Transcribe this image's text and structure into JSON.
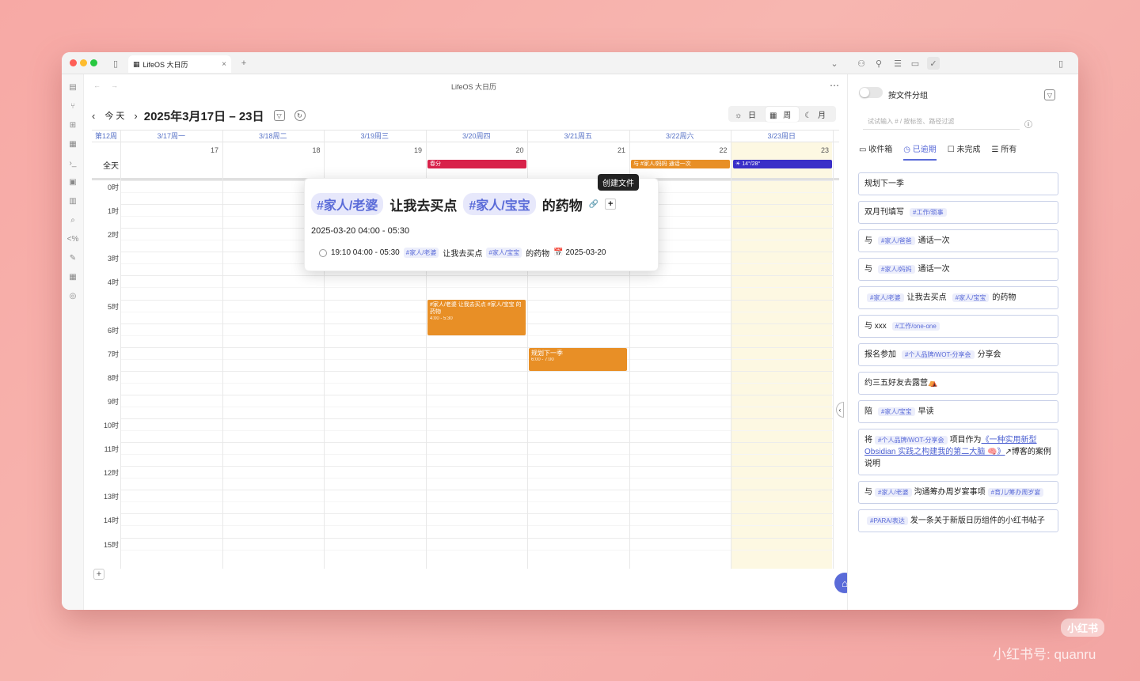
{
  "tab": {
    "title": "LifeOS 大日历"
  },
  "nav": {
    "title": "LifeOS 大日历"
  },
  "header": {
    "title": "2025年3月17日 – 23日",
    "today": "今 天",
    "views": {
      "day": "日",
      "week": "周",
      "month": "月"
    }
  },
  "calendar": {
    "week_label": "第12周",
    "all_day_label": "全天",
    "days": [
      {
        "header": "3/17周一",
        "num": "17"
      },
      {
        "header": "3/18周二",
        "num": "18"
      },
      {
        "header": "3/19周三",
        "num": "19"
      },
      {
        "header": "3/20周四",
        "num": "20"
      },
      {
        "header": "3/21周五",
        "num": "21"
      },
      {
        "header": "3/22周六",
        "num": "22"
      },
      {
        "header": "3/23周日",
        "num": "23"
      }
    ],
    "hours": [
      "0时",
      "1时",
      "2时",
      "3时",
      "4时",
      "5时",
      "6时",
      "7时",
      "8时",
      "9时",
      "10时",
      "11时",
      "12时",
      "13时",
      "14时",
      "15时"
    ],
    "allday_events": [
      {
        "text": "春分",
        "color": "#d8224a"
      },
      {
        "text": "与  #家人/妈妈  通话一次",
        "color": "#e88f26"
      },
      {
        "text": "☀ 14°/28°",
        "color": "#3a2fc8"
      }
    ],
    "events": [
      {
        "title": "#家人/老婆  让我去买点  #家人/宝宝  的药物",
        "time": "4:00 - 5:30"
      },
      {
        "title": "规划下一季",
        "time": "6:00 - 7:00"
      }
    ]
  },
  "popup": {
    "tag1": "#家人/老婆",
    "text1": "让我去买点",
    "tag2": "#家人/宝宝",
    "text2": "的药物",
    "datetime": "2025-03-20 04:00 - 05:30",
    "line_time": "19:10 04:00 - 05:30",
    "line_tag1": "#家人/老婆",
    "line_text1": "让我去买点",
    "line_tag2": "#家人/宝宝",
    "line_text2": "的药物",
    "line_date": "📅 2025-03-20",
    "tooltip": "创建文件"
  },
  "sidebar": {
    "group_label": "按文件分组",
    "search_placeholder": "试试输入 # / 按标签、路径过滤",
    "filters": [
      "收件箱",
      "已逾期",
      "未完成",
      "所有"
    ],
    "tasks": [
      {
        "pre": "规划下一季",
        "tag": "",
        "post": "",
        "tag2": "",
        "post2": ""
      },
      {
        "pre": "双月刊填写",
        "tag": "#工作/琐事",
        "post": "",
        "tag2": "",
        "post2": ""
      },
      {
        "pre": "与",
        "tag": "#家人/爸爸",
        "post": "通话一次",
        "tag2": "",
        "post2": ""
      },
      {
        "pre": "与",
        "tag": "#家人/妈妈",
        "post": "通话一次",
        "tag2": "",
        "post2": ""
      },
      {
        "pre": "",
        "tag": "#家人/老婆",
        "post": "让我去买点",
        "tag2": "#家人/宝宝",
        "post2": "的药物"
      },
      {
        "pre": "与 xxx",
        "tag": "#工作/one-one",
        "post": "",
        "tag2": "",
        "post2": ""
      },
      {
        "pre": "报名参加",
        "tag": "#个人品牌/WOT-分享会",
        "post": "分享会",
        "tag2": "",
        "post2": ""
      },
      {
        "pre": "约三五好友去露营⛺",
        "tag": "",
        "post": "",
        "tag2": "",
        "post2": ""
      },
      {
        "pre": "陪",
        "tag": "#家人/宝宝",
        "post": "早读",
        "tag2": "",
        "post2": ""
      }
    ],
    "task_long": {
      "pre": "将",
      "tag": "#个人品牌/WOT-分享会",
      "mid": "项目作为",
      "link": "《一种实用新型 Obsidian 实践之构建我的第二大脑 🧠》",
      "post": "↗博客的案例说明"
    },
    "task_c": {
      "pre": "与",
      "tag": "#家人/老婆",
      "mid": "沟通筹办周岁宴事项",
      "tag2": "#育儿/筹办周岁宴"
    },
    "task_d": {
      "tag": "#PARA/表达",
      "post": "发一条关于新版日历组件的小红书帖子"
    }
  },
  "watermark": {
    "brand": "小红书",
    "id": "小红书号: quanru"
  },
  "colors": {
    "accent": "#5a6bd8",
    "orange": "#e88f26",
    "red": "#d8224a",
    "indigo": "#3a2fc8"
  }
}
